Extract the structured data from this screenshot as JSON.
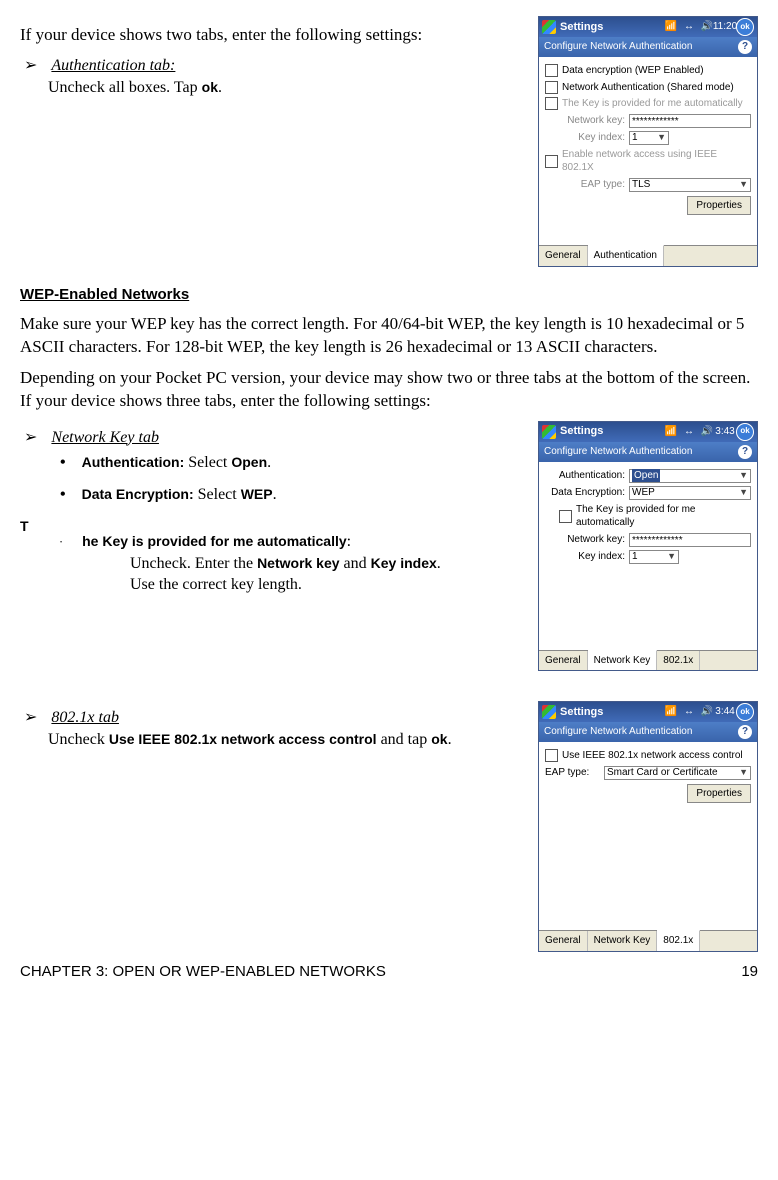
{
  "section1": {
    "intro": "If your device shows two tabs, enter the following settings:",
    "auth_tab_label": "Authentication tab:",
    "auth_tab_instr": "Uncheck all boxes. Tap ",
    "auth_tab_ok": "ok",
    "period": "."
  },
  "wep": {
    "heading": "WEP-Enabled Networks",
    "p1": "Make sure your WEP key has the correct length. For 40/64-bit WEP, the key length is 10 hexadecimal or 5 ASCII characters. For 128-bit WEP, the key length is 26 hexadecimal or 13 ASCII characters.",
    "p2": "Depending on your Pocket PC version, your device may show two or three tabs at the bottom of the screen. If your device shows three tabs, enter the following settings:",
    "netkey_tab": "Network Key tab",
    "b1_label": "Authentication:",
    "b1_val": " Select ",
    "b1_sel": "Open",
    "b2_label": "Data Encryption:",
    "b2_val": " Select ",
    "b2_sel": "WEP",
    "floating_T": "T",
    "sd_rest": "he Key is provided for me automatically",
    "sd_colon": ":",
    "sd_line2a": "Uncheck. Enter the ",
    "sd_nk": "Network key",
    "sd_and": " and ",
    "sd_ki": "Key index",
    "sd_line3": "Use the correct key length.",
    "tab8021x": "802.1x tab",
    "tab8021x_instr1": "Uncheck ",
    "tab8021x_bold": "Use IEEE 802.1x network access control",
    "tab8021x_instr2": " and tap ",
    "tab8021x_ok": "ok"
  },
  "ppc1": {
    "title": "Settings",
    "time": "11:20",
    "sub": "Configure Network Authentication",
    "c1": "Data encryption (WEP Enabled)",
    "c2": "Network Authentication (Shared mode)",
    "c3": "The Key is provided for me automatically",
    "nk_label": "Network key:",
    "nk_val": "************",
    "ki_label": "Key index:",
    "ki_val": "1",
    "c4": "Enable network access using IEEE 802.1X",
    "eap_label": "EAP type:",
    "eap_val": "TLS",
    "props": "Properties",
    "tab1": "General",
    "tab2": "Authentication"
  },
  "ppc2": {
    "title": "Settings",
    "time": "3:43",
    "sub": "Configure Network Authentication",
    "auth_label": "Authentication:",
    "auth_val": "Open",
    "de_label": "Data Encryption:",
    "de_val": "WEP",
    "c1": "The Key is provided for me automatically",
    "nk_label": "Network key:",
    "nk_val": "*************",
    "ki_label": "Key index:",
    "ki_val": "1",
    "tab1": "General",
    "tab2": "Network Key",
    "tab3": "802.1x"
  },
  "ppc3": {
    "title": "Settings",
    "time": "3:44",
    "sub": "Configure Network Authentication",
    "c1": "Use IEEE 802.1x network access control",
    "eap_label": "EAP type:",
    "eap_val": "Smart Card or Certificate",
    "props": "Properties",
    "tab1": "General",
    "tab2": "Network Key",
    "tab3": "802.1x"
  },
  "footer": {
    "chapter": "CHAPTER 3: OPEN OR WEP-ENABLED NETWORKS",
    "page": "19"
  }
}
